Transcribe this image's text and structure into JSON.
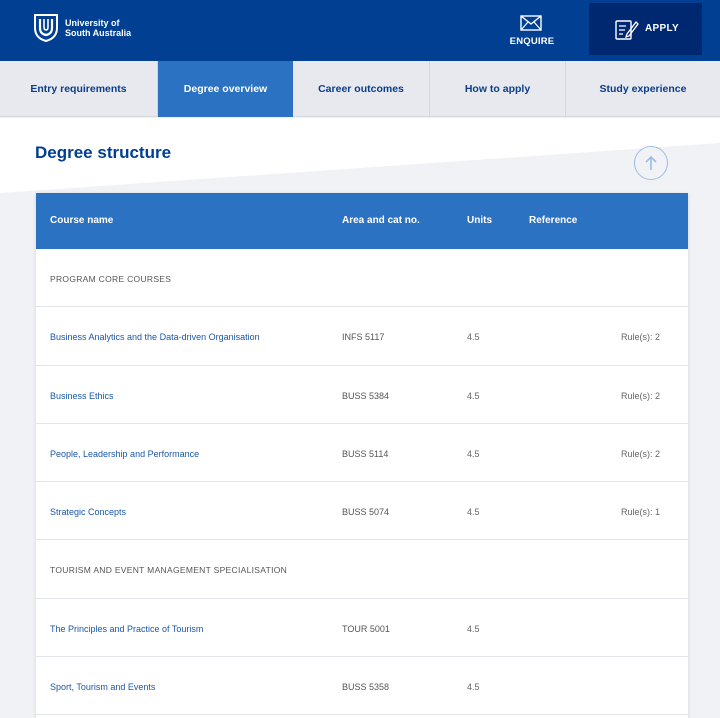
{
  "header": {
    "logo_line1": "University of",
    "logo_line2": "South Australia",
    "enquire_label": "ENQUIRE",
    "apply_label": "APPLY"
  },
  "tabs": [
    {
      "label": "Entry requirements",
      "active": false
    },
    {
      "label": "Degree overview",
      "active": true
    },
    {
      "label": "Career outcomes",
      "active": false
    },
    {
      "label": "How to apply",
      "active": false
    },
    {
      "label": "Study experience",
      "active": false
    }
  ],
  "section_title": "Degree structure",
  "table": {
    "headers": {
      "course": "Course name",
      "area": "Area and cat no.",
      "units": "Units",
      "reference": "Reference"
    },
    "rows": [
      {
        "type": "section",
        "label": "PROGRAM CORE COURSES"
      },
      {
        "type": "course",
        "name": "Business Analytics and the Data-driven Organisation",
        "code": "INFS 5117",
        "units": "4.5",
        "ref": "Rule(s): 2"
      },
      {
        "type": "course",
        "name": "Business Ethics",
        "code": "BUSS 5384",
        "units": "4.5",
        "ref": "Rule(s): 2"
      },
      {
        "type": "course",
        "name": "People, Leadership and Performance",
        "code": "BUSS 5114",
        "units": "4.5",
        "ref": "Rule(s): 2"
      },
      {
        "type": "course",
        "name": "Strategic Concepts",
        "code": "BUSS 5074",
        "units": "4.5",
        "ref": "Rule(s): 1"
      },
      {
        "type": "section",
        "label": "TOURISM AND EVENT MANAGEMENT SPECIALISATION"
      },
      {
        "type": "course",
        "name": "The Principles and Practice of Tourism",
        "code": "TOUR 5001",
        "units": "4.5",
        "ref": ""
      },
      {
        "type": "course",
        "name": "Sport, Tourism and Events",
        "code": "BUSS 5358",
        "units": "4.5",
        "ref": ""
      }
    ]
  },
  "colors": {
    "header_bg": "#003f91",
    "apply_bg": "#002870",
    "accent": "#2c72c2",
    "link": "#1a57a8"
  }
}
